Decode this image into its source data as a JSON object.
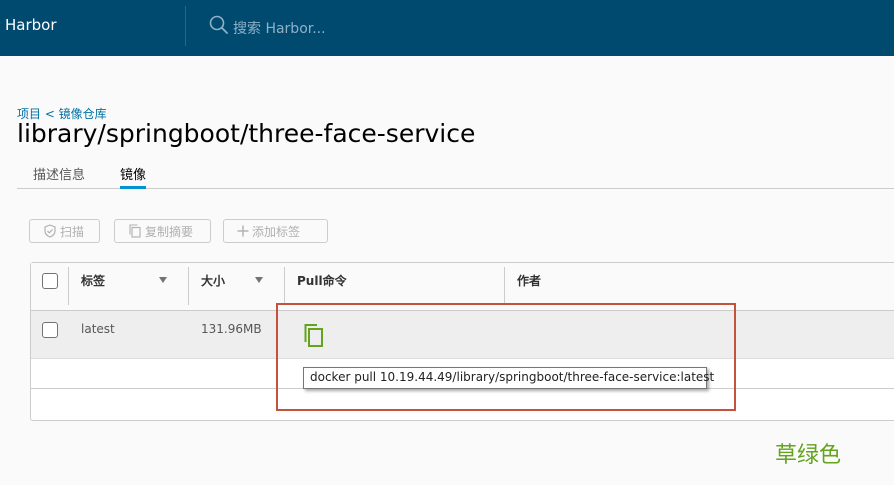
{
  "header": {
    "brand": "Harbor",
    "search_placeholder": "搜索 Harbor..."
  },
  "breadcrumb": "项目 < 镜像仓库",
  "page_title": "library/springboot/three-face-service",
  "tabs": [
    {
      "label": "描述信息"
    },
    {
      "label": "镜像"
    }
  ],
  "toolbar": {
    "scan_label": "扫描",
    "copy_digest_label": "复制摘要",
    "add_label_label": "添加标签"
  },
  "grid": {
    "columns": [
      "标签",
      "大小",
      "Pull命令",
      "作者"
    ],
    "rows": [
      {
        "tag": "latest",
        "size": "131.96MB"
      }
    ]
  },
  "tooltip": "docker pull 10.19.44.49/library/springboot/three-face-service:latest",
  "annotation": "草绿色",
  "colors": {
    "header": "#004a70",
    "accent": "#0094d2",
    "copy_icon": "#62a420",
    "highlight": "#c4533b",
    "annotation": "#63a31e"
  }
}
